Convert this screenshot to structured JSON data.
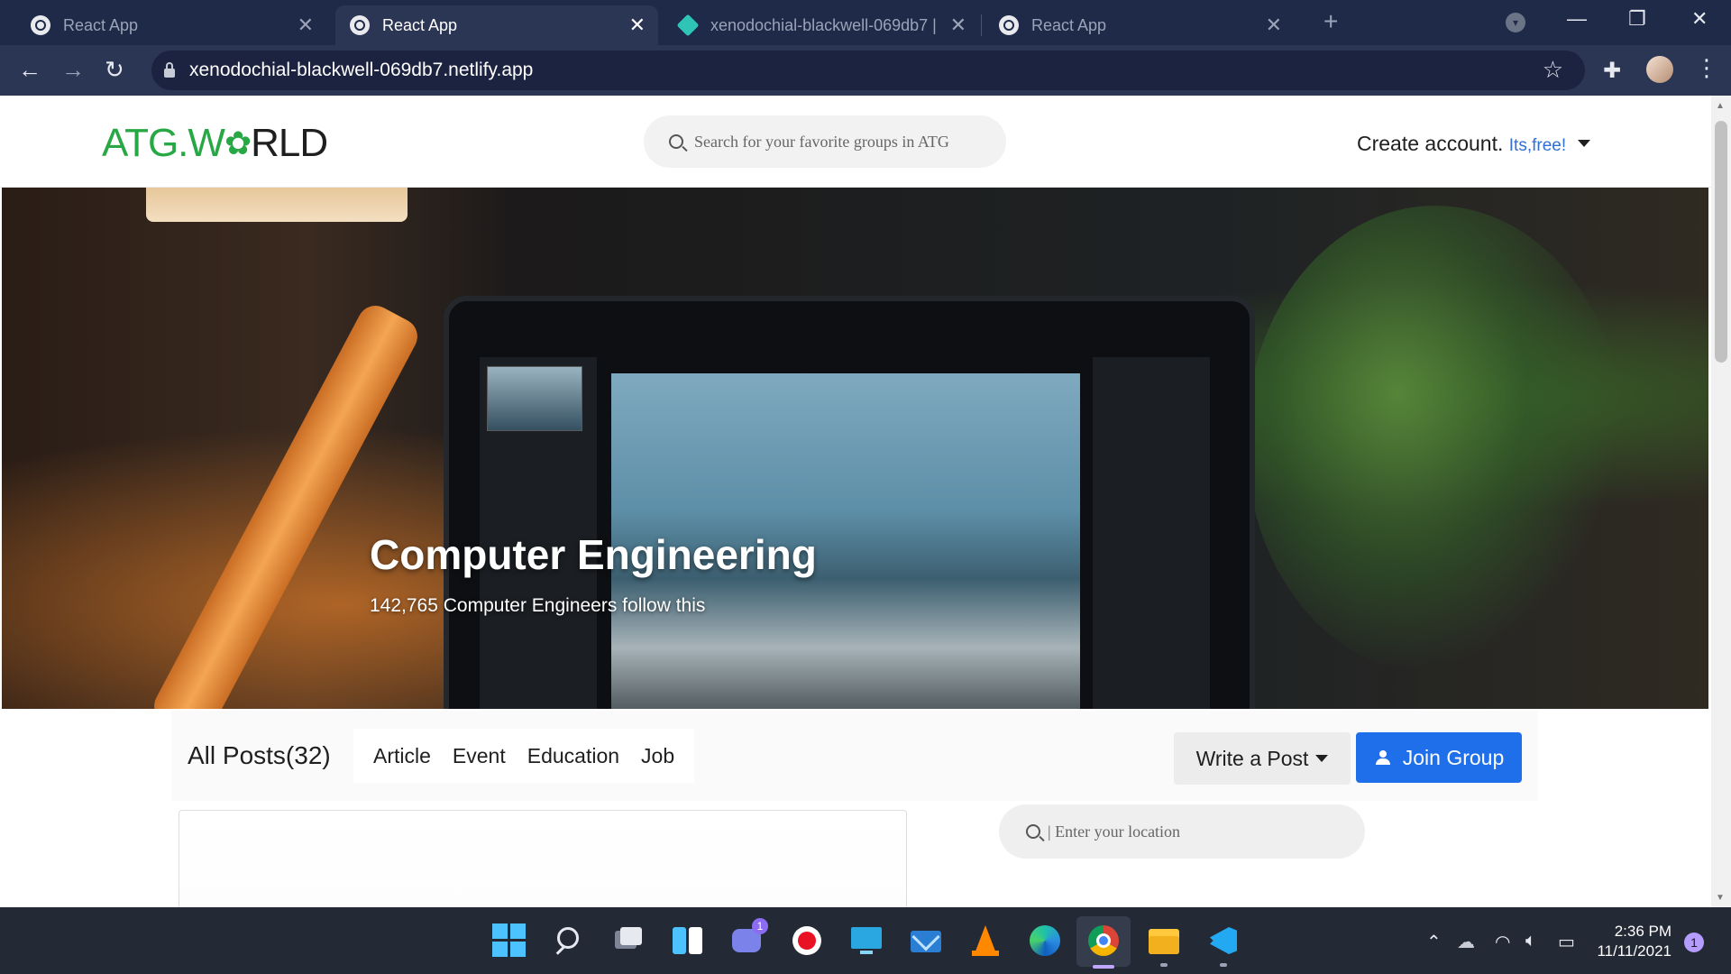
{
  "browser": {
    "tabs": [
      {
        "title": "React App",
        "active": false
      },
      {
        "title": "React App",
        "active": true
      },
      {
        "title": "xenodochial-blackwell-069db7 |",
        "active": false
      },
      {
        "title": "React App",
        "active": false
      }
    ],
    "url": "xenodochial-blackwell-069db7.netlify.app",
    "new_tab_symbol": "+",
    "window_controls": {
      "minimize": "—",
      "restore": "❐",
      "close": "✕"
    }
  },
  "site": {
    "logo": {
      "part1": "ATG.W",
      "part2": "RLD",
      "gear": "✿"
    },
    "search_placeholder": "Search for your favorite groups in ATG",
    "create_account": "Create account.",
    "create_free": "Its,free!"
  },
  "hero": {
    "title": "Computer Engineering",
    "subtitle": "142,765 Computer Engineers follow this"
  },
  "posts_bar": {
    "all_posts": "All Posts(32)",
    "filters": [
      "Article",
      "Event",
      "Education",
      "Job"
    ],
    "write_post": "Write a Post",
    "join_group": "Join Group"
  },
  "location_placeholder": "| Enter your location",
  "taskbar": {
    "time": "2:36 PM",
    "date": "11/11/2021",
    "notifications": "1",
    "chat_badge": "1",
    "apps": [
      "start",
      "search",
      "task-view",
      "widgets",
      "chat",
      "record",
      "desktop",
      "mail",
      "vlc",
      "edge",
      "chrome",
      "file-explorer",
      "vscode"
    ]
  },
  "colors": {
    "brand_green": "#27a844",
    "join_blue": "#1f6feb",
    "link_blue": "#2f6fd6",
    "chrome_dark": "#1f2a48"
  }
}
